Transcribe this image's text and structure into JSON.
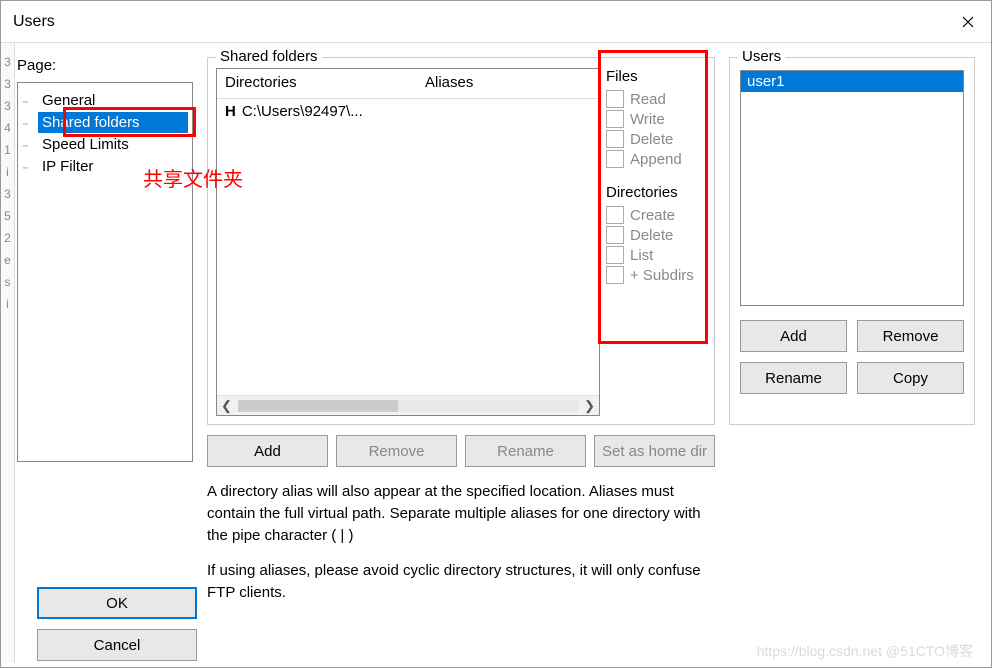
{
  "window": {
    "title": "Users"
  },
  "page_label": "Page:",
  "tree": {
    "items": [
      "General",
      "Shared folders",
      "Speed Limits",
      "IP Filter"
    ],
    "selected_index": 1
  },
  "annotation": "共享文件夹",
  "shared_folders": {
    "legend": "Shared folders",
    "columns": {
      "dir": "Directories",
      "alias": "Aliases"
    },
    "rows": [
      {
        "h": "H",
        "path": "C:\\Users\\92497\\..."
      }
    ],
    "files_perm": {
      "title": "Files",
      "items": [
        "Read",
        "Write",
        "Delete",
        "Append"
      ]
    },
    "dirs_perm": {
      "title": "Directories",
      "items": [
        "Create",
        "Delete",
        "List",
        "+ Subdirs"
      ]
    },
    "buttons": {
      "add": "Add",
      "remove": "Remove",
      "rename": "Rename",
      "sethome": "Set as home dir"
    }
  },
  "hint1": "A directory alias will also appear at the specified location. Aliases must contain the full virtual path. Separate multiple aliases for one directory with the pipe character ( | )",
  "hint2": "If using aliases, please avoid cyclic directory structures, it will only confuse FTP clients.",
  "users": {
    "legend": "Users",
    "items": [
      "user1"
    ],
    "buttons": {
      "add": "Add",
      "remove": "Remove",
      "rename": "Rename",
      "copy": "Copy"
    }
  },
  "bottom": {
    "ok": "OK",
    "cancel": "Cancel"
  },
  "watermark": "https://blog.csdn.net @51CTO博客"
}
